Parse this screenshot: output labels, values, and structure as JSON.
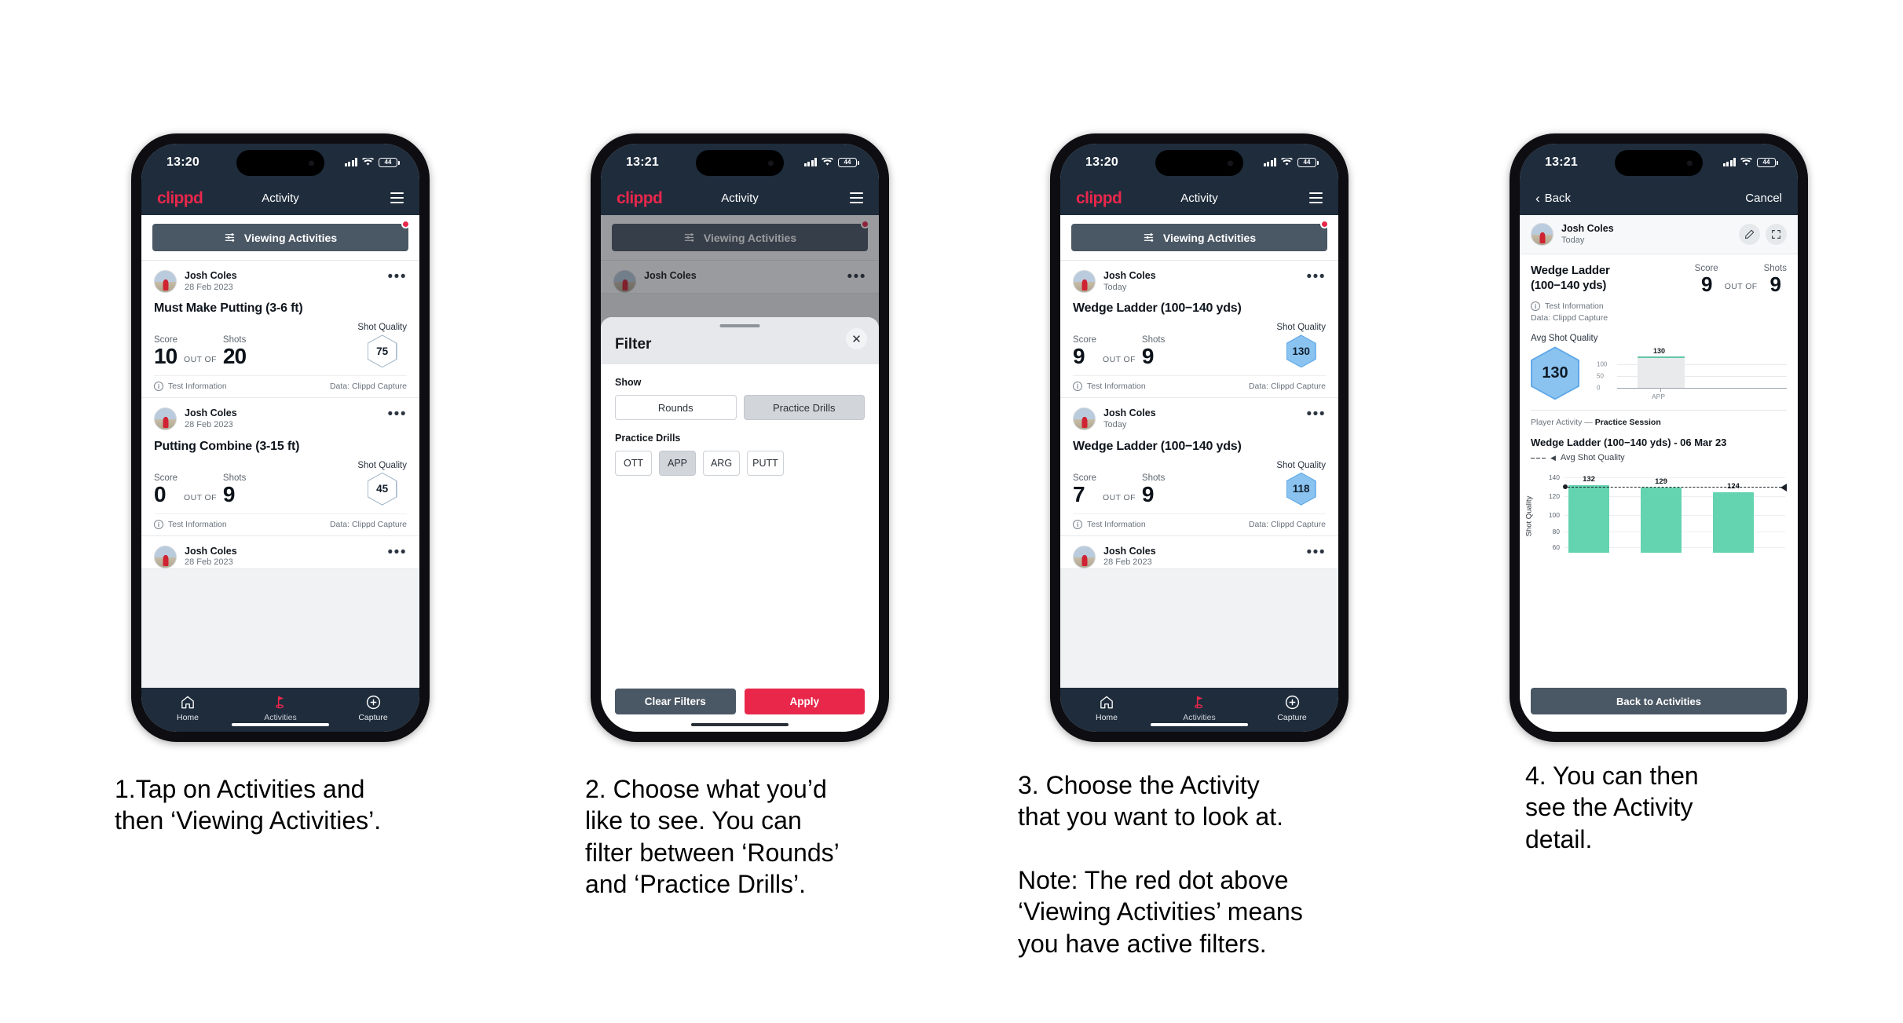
{
  "statusbar": {
    "time_1320": "13:20",
    "time_1321": "13:21",
    "battery": "44"
  },
  "app": {
    "brand": "clippd",
    "title": "Activity",
    "filter_button": "Viewing Activities",
    "tabs": [
      {
        "label": "Home",
        "icon": "home-icon"
      },
      {
        "label": "Activities",
        "icon": "golf-flag-icon"
      },
      {
        "label": "Capture",
        "icon": "plus-circle-icon"
      }
    ]
  },
  "labels": {
    "score": "Score",
    "shots": "Shots",
    "shot_quality": "Shot Quality",
    "out_of": "OUT OF",
    "test_information": "Test Information",
    "data_source": "Data: Clippd Capture"
  },
  "phone1": {
    "cards": [
      {
        "user": "Josh Coles",
        "date": "28 Feb 2023",
        "title": "Must Make Putting (3-6 ft)",
        "score": "10",
        "shots": "20",
        "quality": "75",
        "quality_filled": false
      },
      {
        "user": "Josh Coles",
        "date": "28 Feb 2023",
        "title": "Putting Combine (3-15 ft)",
        "score": "0",
        "shots": "9",
        "quality": "45",
        "quality_filled": false
      },
      {
        "user": "Josh Coles",
        "date": "28 Feb 2023"
      }
    ]
  },
  "phone2": {
    "peek_user": "Josh Coles",
    "filter": {
      "title": "Filter",
      "close_icon": "close-icon",
      "show_label": "Show",
      "show_options": [
        {
          "label": "Rounds",
          "selected": false
        },
        {
          "label": "Practice Drills",
          "selected": true
        }
      ],
      "drills_label": "Practice Drills",
      "drill_options": [
        {
          "label": "OTT",
          "selected": false
        },
        {
          "label": "APP",
          "selected": true
        },
        {
          "label": "ARG",
          "selected": false
        },
        {
          "label": "PUTT",
          "selected": false
        }
      ],
      "clear_button": "Clear Filters",
      "apply_button": "Apply"
    }
  },
  "phone3": {
    "cards": [
      {
        "user": "Josh Coles",
        "date": "Today",
        "title": "Wedge Ladder (100−140 yds)",
        "score": "9",
        "shots": "9",
        "quality": "130",
        "quality_filled": true
      },
      {
        "user": "Josh Coles",
        "date": "Today",
        "title": "Wedge Ladder (100−140 yds)",
        "score": "7",
        "shots": "9",
        "quality": "118",
        "quality_filled": true
      },
      {
        "user": "Josh Coles",
        "date": "28 Feb 2023"
      }
    ]
  },
  "phone4": {
    "nav": {
      "back": "Back",
      "cancel": "Cancel",
      "back_icon": "chevron-left-icon"
    },
    "user": "Josh Coles",
    "date": "Today",
    "edit_icon": "pencil-icon",
    "expand_icon": "expand-icon",
    "title": "Wedge Ladder\n(100−140 yds)",
    "score": "9",
    "shots": "9",
    "avg_label": "Avg Shot Quality",
    "avg_value": "130",
    "section_prefix": "Player Activity — ",
    "section_bold": "Practice Session",
    "chart_title": "Wedge Ladder (100−140 yds) - 06 Mar 23",
    "legend": "Avg Shot Quality",
    "back_button": "Back to Activities"
  },
  "chart_data": [
    {
      "type": "bar",
      "id": "mini-avg-shot-quality",
      "categories": [
        "APP"
      ],
      "values": [
        130
      ],
      "data_labels": [
        "130"
      ],
      "title": "",
      "xlabel": "",
      "ylabel": "",
      "yticks": [
        0,
        50,
        100
      ],
      "ytick_labels": [
        "0",
        "50",
        "100"
      ],
      "ylim": [
        0,
        145
      ],
      "bar_color": "#e8eaec",
      "cap_color": "#63c6a8",
      "grid": true,
      "legend": "none"
    },
    {
      "type": "bar",
      "id": "shot-quality-by-shot",
      "title": "Wedge Ladder (100−140 yds) - 06 Mar 23",
      "categories": [
        "1",
        "2",
        "3"
      ],
      "values": [
        132,
        129,
        124
      ],
      "data_labels": [
        "132",
        "129",
        "124"
      ],
      "xlabel": "",
      "ylabel": "Shot Quality",
      "yticks": [
        60,
        80,
        100,
        120,
        140
      ],
      "ytick_labels": [
        "60",
        "80",
        "100",
        "120",
        "140"
      ],
      "ylim": [
        50,
        145
      ],
      "bar_color": "#63d3b0",
      "grid": true,
      "annotations": [
        {
          "type": "hline",
          "label": "Avg Shot Quality",
          "value": 130,
          "style": "dashed",
          "color": "#1b2027"
        }
      ],
      "legend": "Avg Shot Quality",
      "legend_position": "top-left"
    }
  ],
  "captions": [
    "1.Tap on Activities and\nthen ‘Viewing Activities’.",
    "2. Choose what you’d\nlike to see. You can\nfilter between ‘Rounds’\nand ‘Practice Drills’.",
    "3. Choose the Activity\nthat you want to look at.\n\nNote: The red dot above\n‘Viewing Activities’ means\nyou have active filters.",
    "4. You can then\nsee the Activity\ndetail."
  ]
}
